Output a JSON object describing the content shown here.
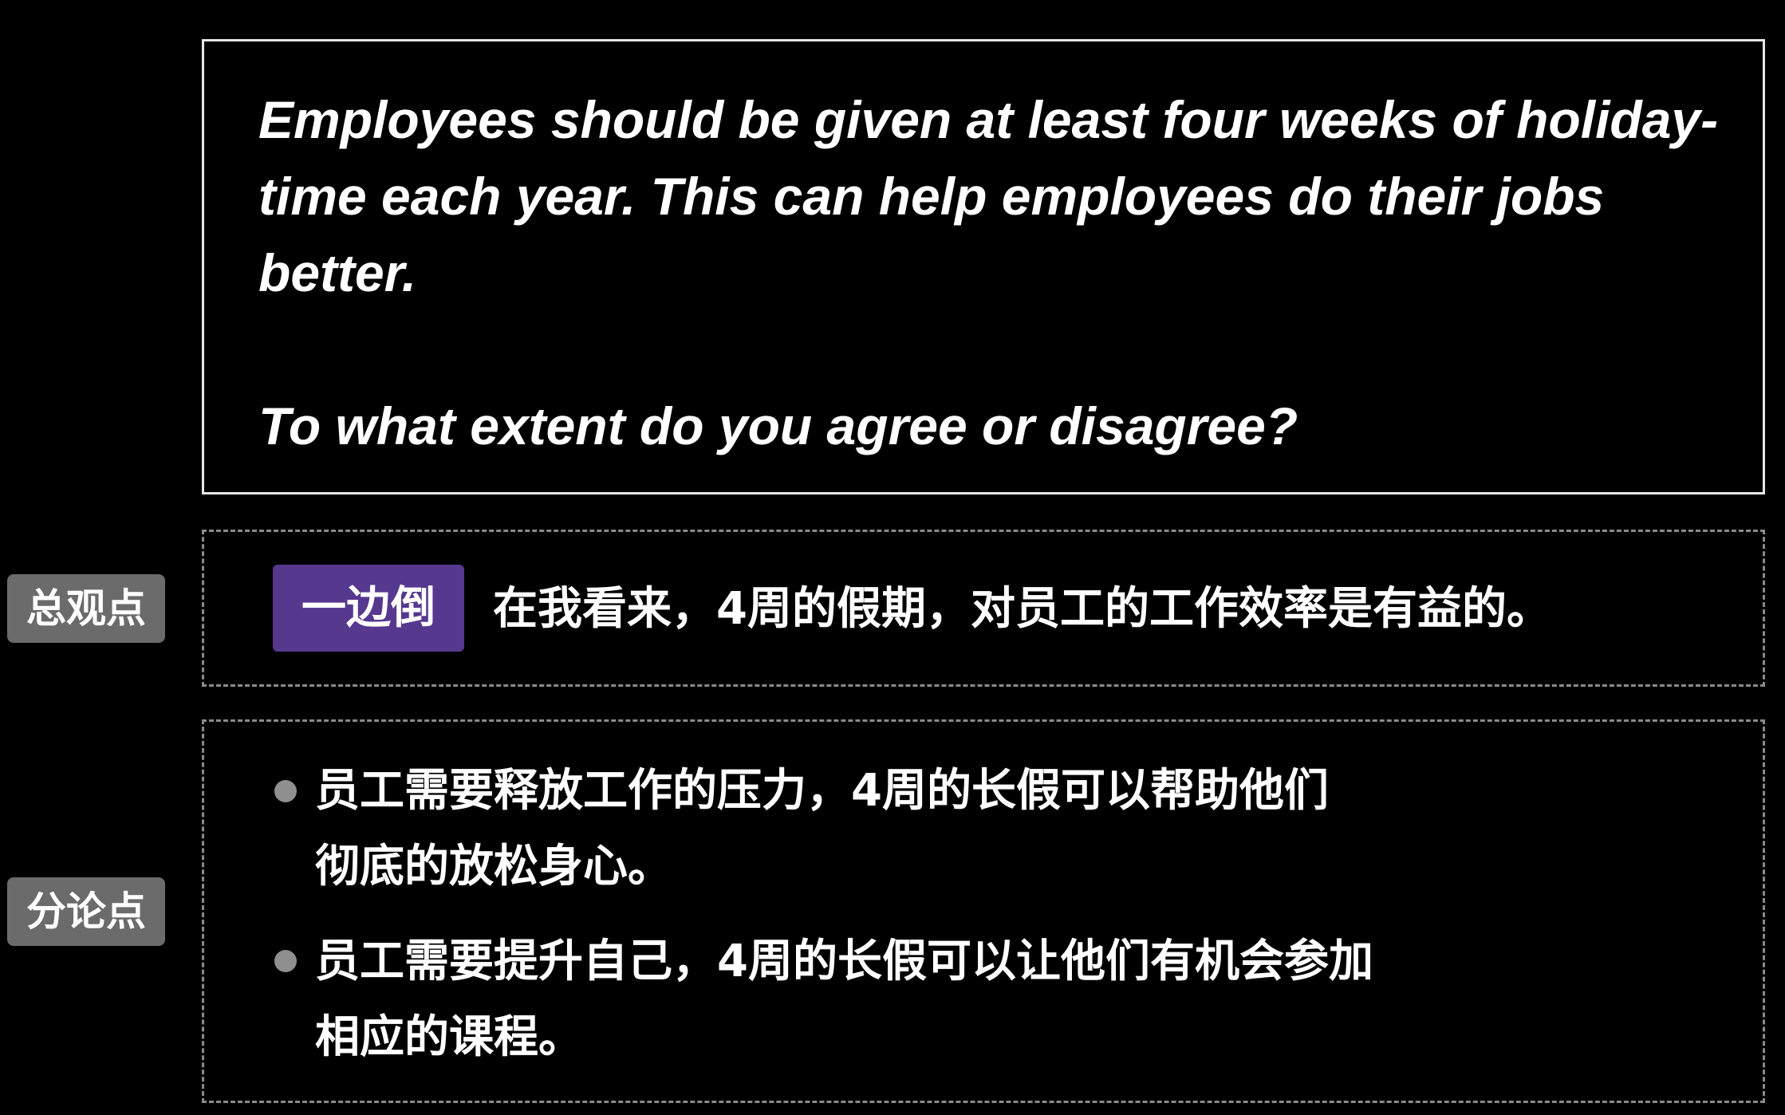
{
  "prompt": {
    "statement": "Employees should be given at least four weeks of holiday-time each year. This can help employees do their jobs better.",
    "question": "To what extent do you agree or disagree?"
  },
  "overall": {
    "side_label": "总观点",
    "tag": "一边倒",
    "text": "在我看来，4周的假期，对员工的工作效率是有益的。"
  },
  "sub_points": {
    "side_label": "分论点",
    "items": [
      {
        "line1": "员工需要释放工作的压力，4周的长假可以帮助他们",
        "line2": "彻底的放松身心。"
      },
      {
        "line1": "员工需要提升自己，4周的长假可以让他们有机会参加",
        "line2": "相应的课程。"
      }
    ]
  },
  "colors": {
    "background": "#000000",
    "tag_background": "#56388f",
    "side_label_background": "#6b6b6b",
    "bullet": "#8f8f8f",
    "dashed_border": "#8a8a8a"
  }
}
